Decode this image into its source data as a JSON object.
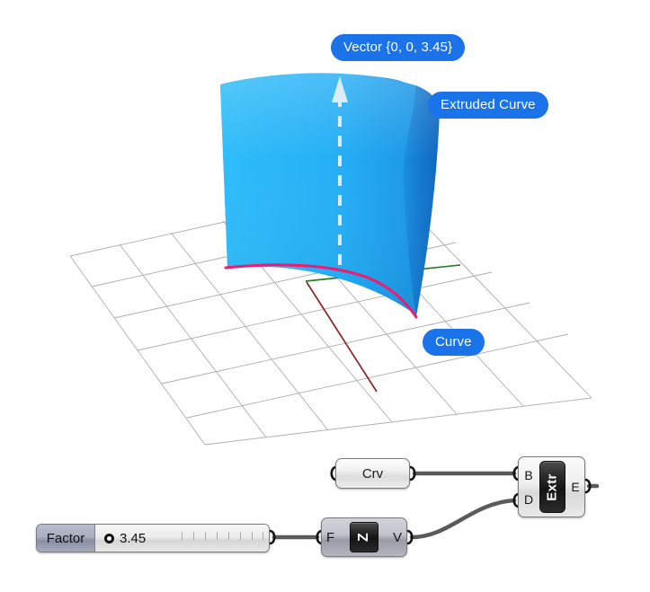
{
  "viewport": {
    "name": "rhino-3d-preview",
    "background": "#ffffff",
    "grid_line_color": "#b0b0b0",
    "axis_x_color": "#2d7a2d",
    "axis_y_color": "#8b2626",
    "surface_color_light": "#29b6f6",
    "surface_color_dark": "#1271cc",
    "curve_color": "#f5196e",
    "vector_arrow_color": "#d7e9f7",
    "labels": {
      "vector": "Vector {0, 0, 3.45}",
      "extruded_curve": "Extruded Curve",
      "curve": "Curve"
    },
    "label_background": "#1a73e8",
    "label_text_color": "#ffffff"
  },
  "canvas": {
    "name": "grasshopper-canvas",
    "nodes": {
      "curve_param": {
        "caption": "Crv",
        "output_label": ""
      },
      "extrude": {
        "icon_text": "Extr",
        "inputs": [
          {
            "label": "B"
          },
          {
            "label": "D"
          }
        ],
        "outputs": [
          {
            "label": "E"
          }
        ]
      },
      "unit_z": {
        "icon_text": "Z",
        "inputs": [
          {
            "label": "F"
          }
        ],
        "outputs": [
          {
            "label": "V"
          }
        ]
      },
      "number_slider": {
        "name_label": "Factor",
        "value": "3.45"
      }
    },
    "wire_color": "#5a5a5a"
  }
}
